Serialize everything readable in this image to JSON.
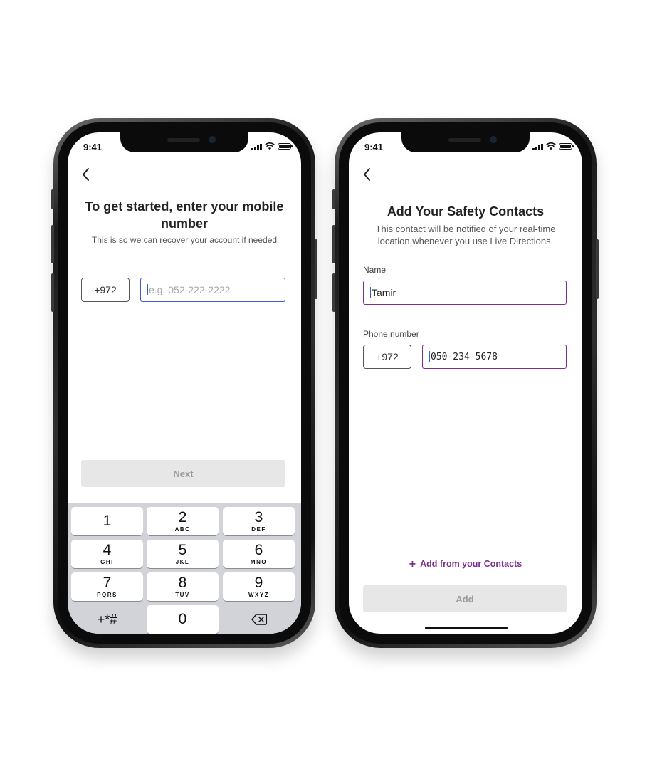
{
  "left_screen": {
    "status_time": "9:41",
    "title": "To get started, enter your mobile number",
    "subtitle": "This is so we can recover your account if needed",
    "country_code": "+972",
    "phone_placeholder": "e.g. 052-222-2222",
    "next_label": "Next",
    "keypad": [
      {
        "digit": "1",
        "letters": ""
      },
      {
        "digit": "2",
        "letters": "ABC"
      },
      {
        "digit": "3",
        "letters": "DEF"
      },
      {
        "digit": "4",
        "letters": "GHI"
      },
      {
        "digit": "5",
        "letters": "JKL"
      },
      {
        "digit": "6",
        "letters": "MNO"
      },
      {
        "digit": "7",
        "letters": "PQRS"
      },
      {
        "digit": "8",
        "letters": "TUV"
      },
      {
        "digit": "9",
        "letters": "WXYZ"
      },
      {
        "digit": "+*#",
        "letters": ""
      },
      {
        "digit": "0",
        "letters": ""
      }
    ]
  },
  "right_screen": {
    "status_time": "9:41",
    "title": "Add Your Safety Contacts",
    "subtitle": "This contact will be notified of your real-time location whenever you use Live Directions.",
    "name_label": "Name",
    "name_value": "Tamir",
    "phone_label": "Phone number",
    "country_code": "+972",
    "phone_value": "050-234-5678",
    "add_from_contacts_label": "Add from your Contacts",
    "add_label": "Add"
  },
  "colors": {
    "accent_purple": "#7a2f8c",
    "focus_blue": "#3a5bd1",
    "disabled_bg": "#e7e7e7"
  }
}
